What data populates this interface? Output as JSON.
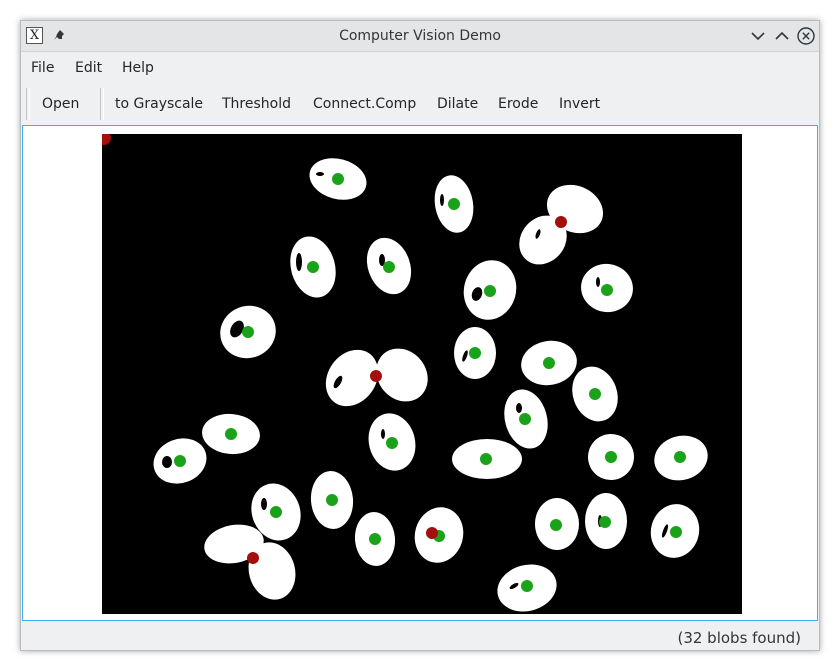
{
  "window": {
    "title": "Computer Vision Demo",
    "icons": {
      "app": "x-window-icon",
      "pin": "pin-icon",
      "minimize": "chevron-down-icon",
      "maximize": "chevron-up-icon",
      "close": "close-circle-icon"
    }
  },
  "menubar": {
    "items": [
      {
        "label": "File"
      },
      {
        "label": "Edit"
      },
      {
        "label": "Help"
      }
    ]
  },
  "toolbar": {
    "items": [
      {
        "label": "Open"
      },
      {
        "label": "to Grayscale"
      },
      {
        "label": "Threshold"
      },
      {
        "label": "Connect.Comp"
      },
      {
        "label": "Dilate"
      },
      {
        "label": "Erode"
      },
      {
        "label": "Invert"
      }
    ]
  },
  "statusbar": {
    "text": "(32 blobs found)"
  },
  "image": {
    "background_color": "#000000",
    "blob_color": "#ffffff",
    "centroid_color": "#1aa31a",
    "merged_centroid_color": "#a30f0f"
  }
}
